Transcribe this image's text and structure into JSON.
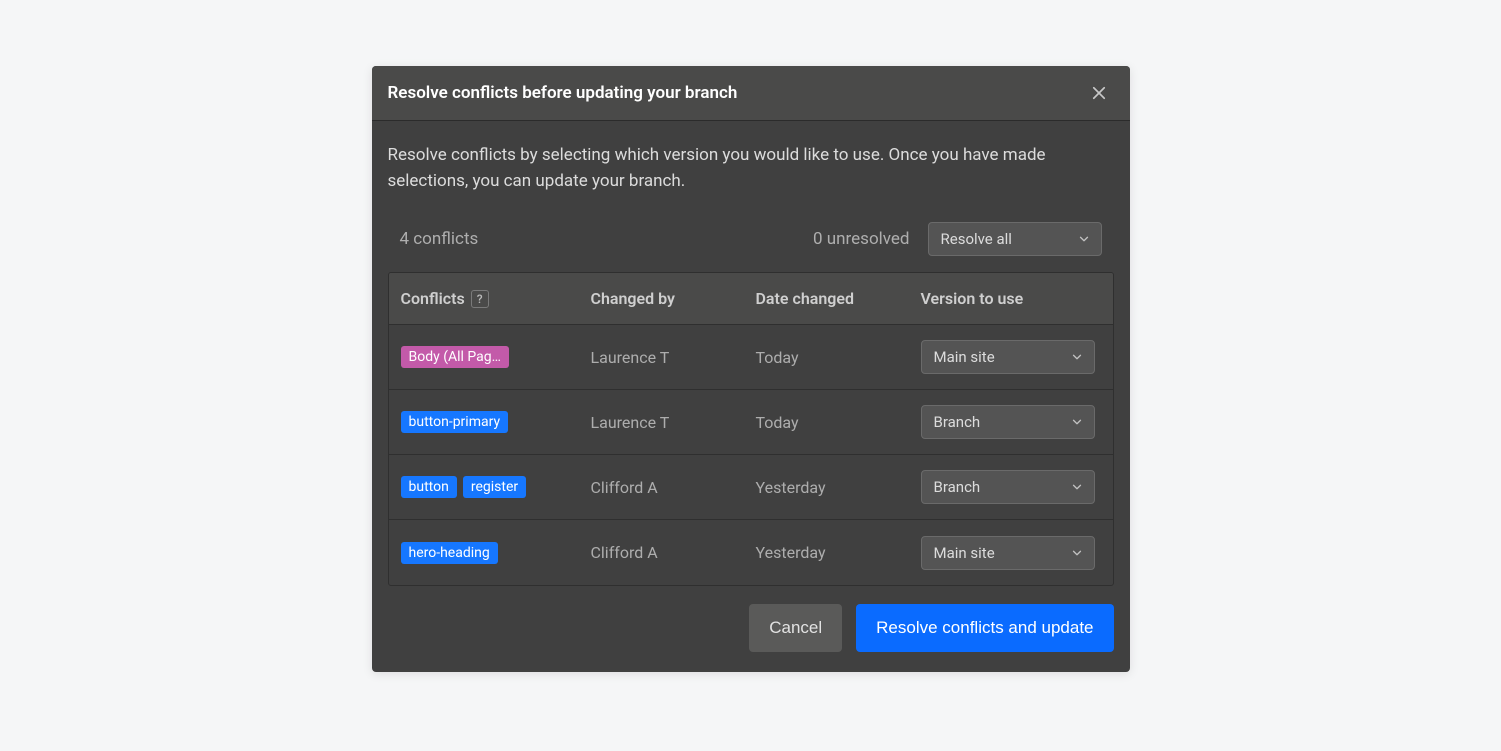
{
  "modal": {
    "title": "Resolve conflicts before updating your branch",
    "description": "Resolve conflicts by selecting which version you would like to use. Once you have made selections, you can update your branch.",
    "stats": {
      "conflicts": "4 conflicts",
      "unresolved": "0 unresolved"
    },
    "resolve_all_label": "Resolve all",
    "columns": {
      "conflicts": "Conflicts",
      "changed_by": "Changed by",
      "date_changed": "Date changed",
      "version_to_use": "Version to use",
      "help": "?"
    },
    "rows": [
      {
        "tags": [
          {
            "text": "Body (All Pag…",
            "color": "magenta"
          }
        ],
        "changed_by": "Laurence T",
        "date_changed": "Today",
        "version": "Main site"
      },
      {
        "tags": [
          {
            "text": "button-primary",
            "color": "blue"
          }
        ],
        "changed_by": "Laurence T",
        "date_changed": "Today",
        "version": "Branch"
      },
      {
        "tags": [
          {
            "text": "button",
            "color": "blue"
          },
          {
            "text": "register",
            "color": "blue"
          }
        ],
        "changed_by": "Clifford A",
        "date_changed": "Yesterday",
        "version": "Branch"
      },
      {
        "tags": [
          {
            "text": "hero-heading",
            "color": "blue"
          }
        ],
        "changed_by": "Clifford A",
        "date_changed": "Yesterday",
        "version": "Main site"
      }
    ],
    "footer": {
      "cancel": "Cancel",
      "resolve": "Resolve conflicts and update"
    }
  }
}
